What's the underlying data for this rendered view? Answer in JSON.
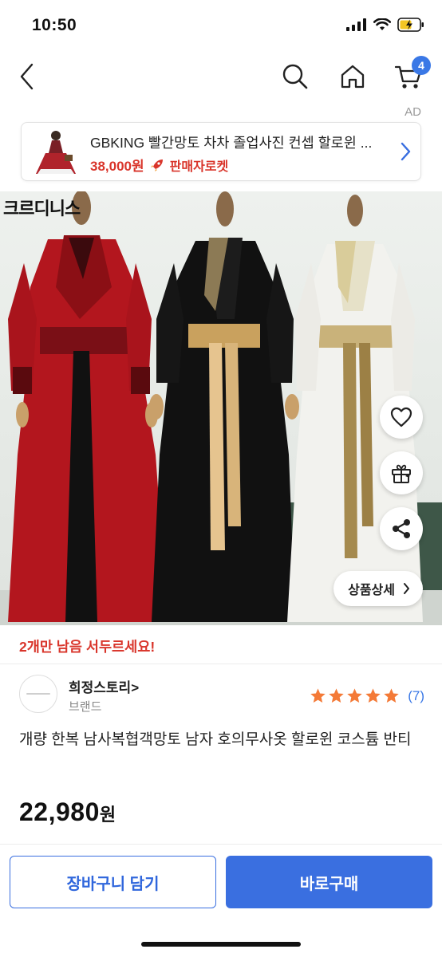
{
  "status": {
    "time": "10:50"
  },
  "nav": {
    "cart_badge": "4"
  },
  "ad": {
    "label": "AD",
    "title": "GBKING 빨간망토 차차 졸업사진 컨셉 할로윈 ...",
    "price": "38,000원",
    "rocket_label": "판매자로켓"
  },
  "hero": {
    "watermark": "크르디니스",
    "detail_button": "상품상세",
    "icons": [
      "heart-icon",
      "gift-icon",
      "share-icon"
    ]
  },
  "urgency": "2개만 남음 서두르세요!",
  "seller": {
    "name": "희정스토리>",
    "sub": "브랜드",
    "rating": 5,
    "review_count": "(7)"
  },
  "product": {
    "title": "개량 한복 남사복협객망토 남자 호의무사옷 할로윈 코스튬 반티",
    "price": "22,980",
    "price_unit": "원"
  },
  "actions": {
    "cart_label": "장바구니 담기",
    "buy_label": "바로구매"
  },
  "colors": {
    "accent": "#3a6fe0",
    "alert": "#d9352b",
    "star": "#f47a37"
  }
}
